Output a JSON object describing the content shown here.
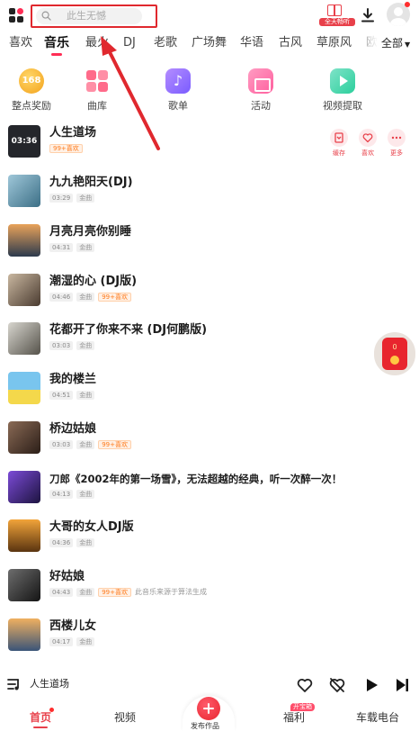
{
  "header": {
    "search_placeholder": "此生无憾",
    "promo_label": "全天畅听"
  },
  "tabs": [
    "喜欢",
    "音乐",
    "最火",
    "DJ",
    "老歌",
    "广场舞",
    "华语",
    "古风",
    "草原风",
    "欧"
  ],
  "active_tab": "音乐",
  "all_label": "全部",
  "entries": [
    {
      "label": "整点奖励",
      "icon": "coin-168-icon",
      "badge": "168"
    },
    {
      "label": "曲库",
      "icon": "library-icon"
    },
    {
      "label": "歌单",
      "icon": "playlist-icon"
    },
    {
      "label": "活动",
      "icon": "event-gift-icon"
    },
    {
      "label": "视频提取",
      "icon": "video-extract-icon"
    }
  ],
  "first_row_actions": [
    {
      "label": "缓存",
      "icon": "cache-download-icon"
    },
    {
      "label": "喜欢",
      "icon": "heart-icon"
    },
    {
      "label": "更多",
      "icon": "more-icon"
    }
  ],
  "songs": [
    {
      "title": "人生道场",
      "duration": "",
      "quality": "",
      "likes": "99+喜欢",
      "note": "",
      "cover_text": "03:36",
      "cover_colors": [
        "#24262b",
        "#24262b"
      ]
    },
    {
      "title": "九九艳阳天(DJ)",
      "duration": "03:29",
      "quality": "金曲",
      "likes": "",
      "note": "",
      "cover_text": "",
      "cover_colors": [
        "#9fc7d9",
        "#3c6f86"
      ]
    },
    {
      "title": "月亮月亮你别睡",
      "duration": "04:31",
      "quality": "金曲",
      "likes": "",
      "note": "",
      "cover_text": "",
      "cover_colors": [
        "#e9a25a",
        "#2c3a4d"
      ]
    },
    {
      "title": "潮湿的心 (DJ版)",
      "duration": "04:46",
      "quality": "金曲",
      "likes": "99+喜欢",
      "note": "",
      "cover_text": "",
      "cover_colors": [
        "#c9b7a0",
        "#4a3b30"
      ]
    },
    {
      "title": "花都开了你来不来 (DJ何鹏版)",
      "duration": "03:03",
      "quality": "金曲",
      "likes": "",
      "note": "",
      "cover_text": "",
      "cover_colors": [
        "#d8d6cf",
        "#55524a"
      ]
    },
    {
      "title": "我的楼兰",
      "duration": "04:51",
      "quality": "金曲",
      "likes": "",
      "note": "",
      "cover_text": "",
      "cover_colors": [
        "#79c5ee",
        "#f4d84b"
      ]
    },
    {
      "title": "桥边姑娘",
      "duration": "03:03",
      "quality": "金曲",
      "likes": "99+喜欢",
      "note": "",
      "cover_text": "",
      "cover_colors": [
        "#8a6a55",
        "#2b1e18"
      ]
    },
    {
      "title": "刀郎《2002年的第一场雪》，无法超越的经典，听一次醉一次！",
      "duration": "04:13",
      "quality": "金曲",
      "likes": "",
      "note": "",
      "cover_text": "",
      "cover_colors": [
        "#7c4bd8",
        "#1d1440"
      ]
    },
    {
      "title": "大哥的女人DJ版",
      "duration": "04:36",
      "quality": "金曲",
      "likes": "",
      "note": "",
      "cover_text": "",
      "cover_colors": [
        "#f2a43a",
        "#5a3410"
      ]
    },
    {
      "title": "好姑娘",
      "duration": "04:43",
      "quality": "金曲",
      "likes": "99+喜欢",
      "note": "此音乐来源于算法生成",
      "cover_text": "",
      "cover_colors": [
        "#6d6d6d",
        "#141414"
      ]
    },
    {
      "title": "西楼儿女",
      "duration": "04:17",
      "quality": "金曲",
      "likes": "",
      "note": "",
      "cover_text": "",
      "cover_colors": [
        "#f0b060",
        "#3a5478"
      ]
    }
  ],
  "float_packet": {
    "count": "0"
  },
  "player": {
    "now_playing": "人生道场"
  },
  "nav": {
    "home": "首页",
    "video": "视频",
    "publish": "发布作品",
    "welfare": "福利",
    "welfare_badge": "开宝箱",
    "radio": "车载电台"
  },
  "colors": {
    "accent": "#e8404a",
    "annotation": "#e0282e"
  }
}
